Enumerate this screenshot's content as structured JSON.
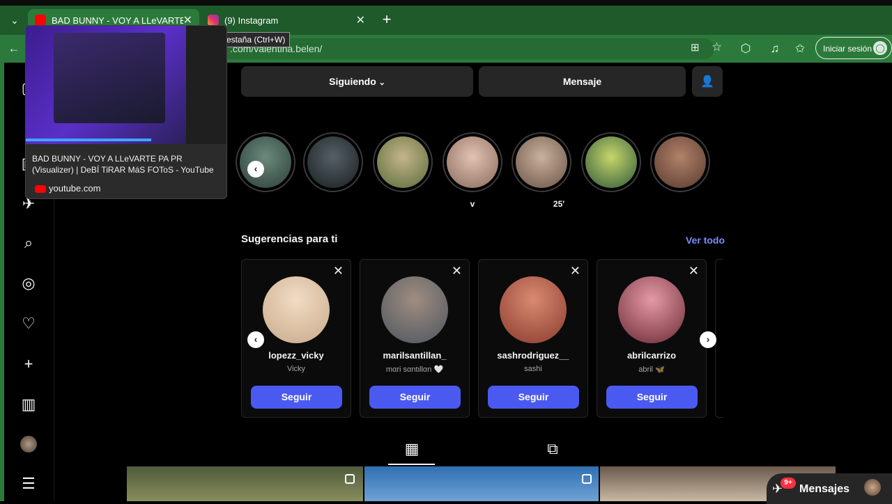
{
  "browser": {
    "tabs": [
      {
        "title": "BAD BUNNY - VOY A LLeVARTE PA PR (Visualizer) | DeBÍ TiRAR MáS FOToS - YouTube",
        "short_title": "BAD BUNNY - VOY A LLeVARTE PA",
        "favicon": "youtube-icon"
      },
      {
        "title": "(9) Instagram",
        "favicon": "instagram-icon"
      }
    ],
    "tooltip": "estaña (Ctrl+W)",
    "url": ".com/valentina.belen/",
    "signin_label": "Iniciar sesión",
    "preview": {
      "title": "BAD BUNNY - VOY A LLeVARTE PA PR (Visualizer) | DeBÍ TiRAR MáS FOToS - YouTube",
      "domain": "youtube.com"
    }
  },
  "profile_actions": {
    "following_label": "Siguiendo",
    "message_label": "Mensaje"
  },
  "stories": [
    {
      "label": "",
      "colors": [
        "#2c3e3a",
        "#6b8a7c"
      ]
    },
    {
      "label": "",
      "colors": [
        "#1a1f22",
        "#556066"
      ]
    },
    {
      "label": "",
      "colors": [
        "#5a6b3a",
        "#c4b58a"
      ]
    },
    {
      "label": "v",
      "colors": [
        "#8a6a5c",
        "#e2c2b3"
      ]
    },
    {
      "label": "25'",
      "colors": [
        "#6a5445",
        "#c9b19d"
      ]
    },
    {
      "label": "",
      "colors": [
        "#2d5a3a",
        "#c8d66a"
      ]
    },
    {
      "label": "",
      "colors": [
        "#5a3a2e",
        "#b0826a"
      ]
    }
  ],
  "suggestions": {
    "title": "Sugerencias para ti",
    "see_all": "Ver todo",
    "follow_label": "Seguir",
    "cards": [
      {
        "username": "lopezz_vicky",
        "fullname": "Vicky",
        "colors": [
          "#c9a98a",
          "#f0dcc4"
        ]
      },
      {
        "username": "marilsantillan_",
        "fullname": "mαri sαntιllαn 🤍",
        "colors": [
          "#4d5560",
          "#a08d80"
        ]
      },
      {
        "username": "sashrodriguez__",
        "fullname": "sashi",
        "colors": [
          "#8a3a2e",
          "#d98a70"
        ]
      },
      {
        "username": "abrilcarrizo",
        "fullname": "abril 🦋",
        "colors": [
          "#6a2a35",
          "#e59aa6"
        ]
      }
    ]
  },
  "messages_pill": {
    "label": "Mensajes",
    "badge": "9+"
  },
  "colors": {
    "browser_green": "#2c7a3b",
    "follow_blue": "#4a5af0",
    "link_blue": "#7b8cff",
    "notification_red": "#ff3040"
  }
}
